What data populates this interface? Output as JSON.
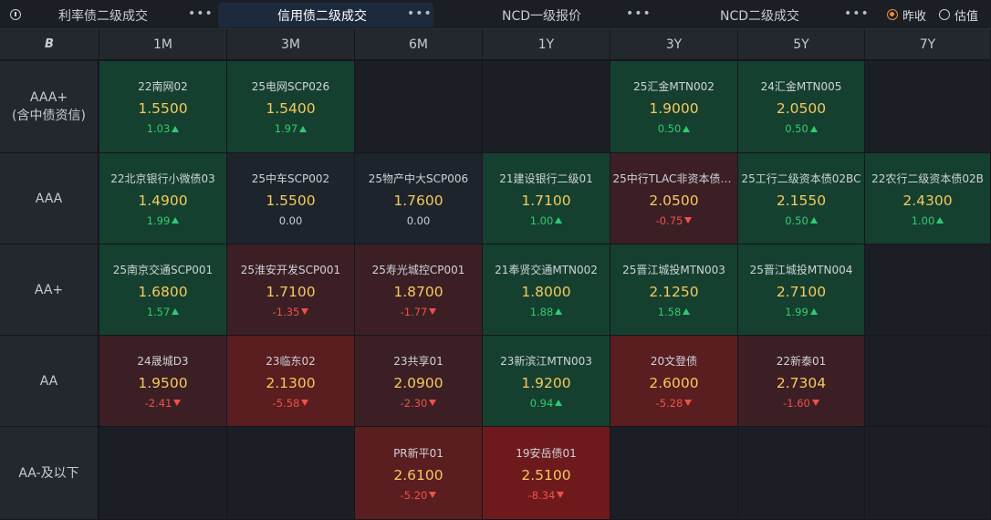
{
  "tabs": [
    {
      "label": "利率债二级成交",
      "active": false
    },
    {
      "label": "信用债二级成交",
      "active": true
    },
    {
      "label": "NCD一级报价",
      "active": false
    },
    {
      "label": "NCD二级成交",
      "active": false
    }
  ],
  "more_label": "•••",
  "price_mode": {
    "options": [
      "昨收",
      "估值"
    ],
    "selected": "昨收"
  },
  "corner_label": "B",
  "columns": [
    "1M",
    "3M",
    "6M",
    "1Y",
    "3Y",
    "5Y",
    "7Y"
  ],
  "rows": [
    {
      "rating": "AAA+\n(含中债资信)",
      "cells": [
        {
          "name": "22南网02",
          "yield": "1.5500",
          "change": "1.03",
          "dir": "up",
          "tone": "g"
        },
        {
          "name": "25电网SCP026",
          "yield": "1.5400",
          "change": "1.97",
          "dir": "up",
          "tone": "g"
        },
        null,
        null,
        {
          "name": "25汇金MTN002",
          "yield": "1.9000",
          "change": "0.50",
          "dir": "up",
          "tone": "g"
        },
        {
          "name": "24汇金MTN005",
          "yield": "2.0500",
          "change": "0.50",
          "dir": "up",
          "tone": "g"
        },
        null
      ]
    },
    {
      "rating": "AAA",
      "cells": [
        {
          "name": "22北京银行小微债03",
          "yield": "1.4900",
          "change": "1.99",
          "dir": "up",
          "tone": "g"
        },
        {
          "name": "25中车SCP002",
          "yield": "1.5500",
          "change": "0.00",
          "dir": "flat",
          "tone": "n"
        },
        {
          "name": "25物产中大SCP006",
          "yield": "1.7600",
          "change": "0.00",
          "dir": "flat",
          "tone": "n"
        },
        {
          "name": "21建设银行二级01",
          "yield": "1.7100",
          "change": "1.00",
          "dir": "up",
          "tone": "g"
        },
        {
          "name": "25中行TLAC非资本债0...",
          "yield": "2.0500",
          "change": "-0.75",
          "dir": "down",
          "tone": "r1"
        },
        {
          "name": "25工行二级资本债02BC",
          "yield": "2.1550",
          "change": "0.50",
          "dir": "up",
          "tone": "g"
        },
        {
          "name": "22农行二级资本债02B",
          "yield": "2.4300",
          "change": "1.00",
          "dir": "up",
          "tone": "g"
        }
      ]
    },
    {
      "rating": "AA+",
      "cells": [
        {
          "name": "25南京交通SCP001",
          "yield": "1.6800",
          "change": "1.57",
          "dir": "up",
          "tone": "g"
        },
        {
          "name": "25淮安开发SCP001",
          "yield": "1.7100",
          "change": "-1.35",
          "dir": "down",
          "tone": "r1"
        },
        {
          "name": "25寿光城控CP001",
          "yield": "1.8700",
          "change": "-1.77",
          "dir": "down",
          "tone": "r1"
        },
        {
          "name": "21奉贤交通MTN002",
          "yield": "1.8000",
          "change": "1.88",
          "dir": "up",
          "tone": "g"
        },
        {
          "name": "25晋江城投MTN003",
          "yield": "2.1250",
          "change": "1.58",
          "dir": "up",
          "tone": "g"
        },
        {
          "name": "25晋江城投MTN004",
          "yield": "2.7100",
          "change": "1.99",
          "dir": "up",
          "tone": "g"
        },
        null
      ]
    },
    {
      "rating": "AA",
      "cells": [
        {
          "name": "24晟城D3",
          "yield": "1.9500",
          "change": "-2.41",
          "dir": "down",
          "tone": "r1"
        },
        {
          "name": "23临东02",
          "yield": "2.1300",
          "change": "-5.58",
          "dir": "down",
          "tone": "r2"
        },
        {
          "name": "23共享01",
          "yield": "2.0900",
          "change": "-2.30",
          "dir": "down",
          "tone": "r1"
        },
        {
          "name": "23新滨江MTN003",
          "yield": "1.9200",
          "change": "0.94",
          "dir": "up",
          "tone": "g"
        },
        {
          "name": "20文登债",
          "yield": "2.6000",
          "change": "-5.28",
          "dir": "down",
          "tone": "r2"
        },
        {
          "name": "22新泰01",
          "yield": "2.7304",
          "change": "-1.60",
          "dir": "down",
          "tone": "r1"
        },
        null
      ]
    },
    {
      "rating": "AA-及以下",
      "cells": [
        null,
        null,
        {
          "name": "PR新平01",
          "yield": "2.6100",
          "change": "-5.20",
          "dir": "down",
          "tone": "r2"
        },
        {
          "name": "19安岳债01",
          "yield": "2.5100",
          "change": "-8.34",
          "dir": "down",
          "tone": "r3"
        },
        null,
        null,
        null
      ]
    }
  ],
  "colors": {
    "up": "#2ecc71",
    "down": "#f0504a",
    "yield": "#f4c95d",
    "accent": "#f08a3c"
  }
}
